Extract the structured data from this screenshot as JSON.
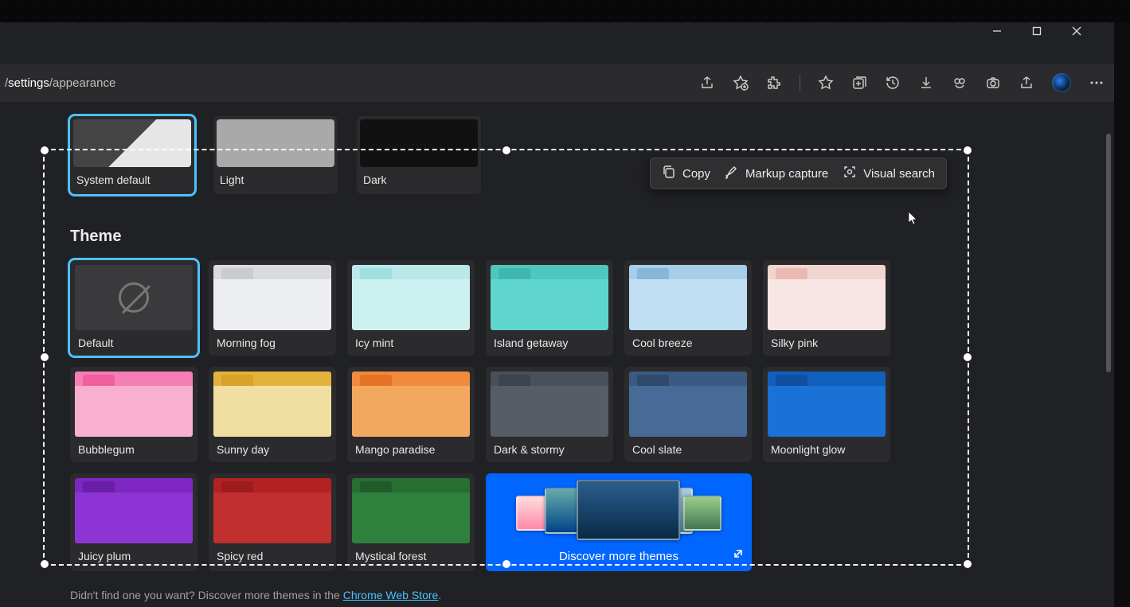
{
  "window_controls": {
    "minimize": "minimize",
    "maximize": "maximize",
    "close": "close"
  },
  "address": {
    "path_prefix": "/",
    "seg1": "settings",
    "sep": "/",
    "seg2": "appearance"
  },
  "toolbar_icons": [
    "share",
    "favorite-add",
    "extensions",
    "favorites",
    "collections",
    "history",
    "downloads",
    "performance",
    "screenshot",
    "share-page",
    "more"
  ],
  "look_section": {
    "items": [
      {
        "label": "System default",
        "selected": true,
        "kind": "sys"
      },
      {
        "label": "Light",
        "selected": false,
        "kind": "lgt"
      },
      {
        "label": "Dark",
        "selected": false,
        "kind": "drk"
      }
    ]
  },
  "theme_heading": "Theme",
  "themes": [
    {
      "label": "Default",
      "tab": "#4a4a4d",
      "bar": "#3a3a3c",
      "body": "#3a3a3c",
      "selected": true,
      "none": true
    },
    {
      "label": "Morning fog",
      "tab": "#c9cbcd",
      "bar": "#d9dbdd",
      "body": "#eceef0"
    },
    {
      "label": "Icy mint",
      "tab": "#9fdfe0",
      "bar": "#b8e8e8",
      "body": "#cdf1f1"
    },
    {
      "label": "Island getaway",
      "tab": "#3fb7af",
      "bar": "#4ec7bf",
      "body": "#5fd6cd"
    },
    {
      "label": "Cool breeze",
      "tab": "#88b6d9",
      "bar": "#a6cde9",
      "body": "#c0dff3"
    },
    {
      "label": "Silky pink",
      "tab": "#e9b9b2",
      "bar": "#f2d5d0",
      "body": "#f7e6e3"
    },
    {
      "label": "Bubblegum",
      "tab": "#ef5fa0",
      "bar": "#f57fb5",
      "body": "#f9b0d0"
    },
    {
      "label": "Sunny day",
      "tab": "#d7a227",
      "bar": "#e2b23a",
      "body": "#f1dfa1"
    },
    {
      "label": "Mango paradise",
      "tab": "#e57325",
      "bar": "#ef8a3f",
      "body": "#f3a85f"
    },
    {
      "label": "Dark & stormy",
      "tab": "#3d434c",
      "bar": "#4a5059",
      "body": "#565d67"
    },
    {
      "label": "Cool slate",
      "tab": "#2f4a6b",
      "bar": "#3a5a82",
      "body": "#476b96"
    },
    {
      "label": "Moonlight glow",
      "tab": "#0e4fa0",
      "bar": "#115fbd",
      "body": "#1a72d6"
    },
    {
      "label": "Juicy plum",
      "tab": "#6a1ea8",
      "bar": "#7d26c2",
      "body": "#8e34d4"
    },
    {
      "label": "Spicy red",
      "tab": "#9e1b1b",
      "bar": "#b32222",
      "body": "#c22f2f"
    },
    {
      "label": "Mystical forest",
      "tab": "#1f5c2a",
      "bar": "#276e33",
      "body": "#2f7f3d"
    }
  ],
  "discover": {
    "label": "Discover more themes"
  },
  "footer": {
    "prefix": "Didn't find one you want? Discover more themes in the ",
    "link": "Chrome Web Store",
    "suffix": "."
  },
  "capture_bar": {
    "copy": "Copy",
    "markup": "Markup capture",
    "visual": "Visual search"
  }
}
